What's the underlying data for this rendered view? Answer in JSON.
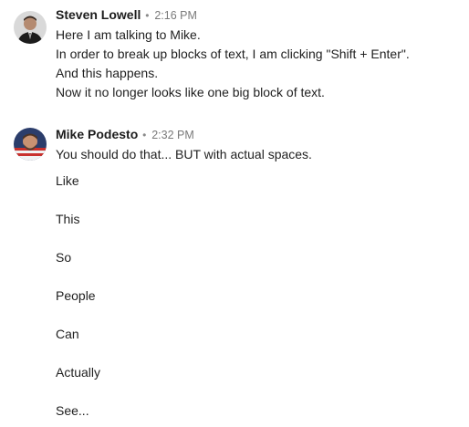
{
  "messages": [
    {
      "author": "Steven Lowell",
      "separator": "•",
      "time": "2:16 PM",
      "lines": [
        "Here I am talking to Mike.",
        "In order to break up blocks of text, I am clicking \"Shift + Enter\".",
        "And this happens.",
        "Now it no longer looks like one big block of text."
      ]
    },
    {
      "author": "Mike Podesto",
      "separator": "•",
      "time": "2:32 PM",
      "lines": [
        "You should do that... BUT with actual spaces."
      ],
      "paragraphs": [
        "Like",
        "This",
        "So",
        "People",
        "Can",
        "Actually",
        "See..."
      ]
    }
  ]
}
